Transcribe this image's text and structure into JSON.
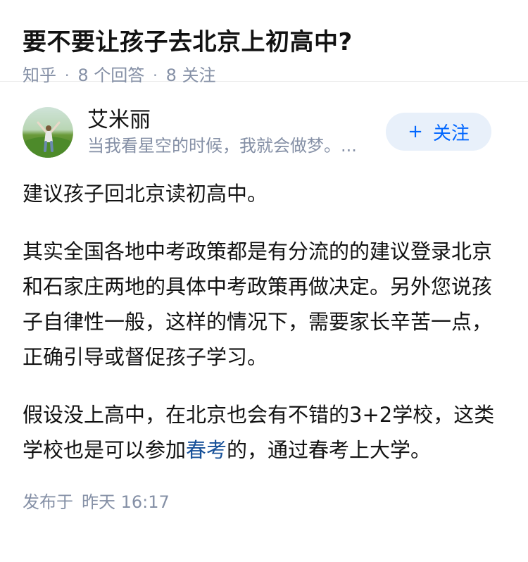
{
  "question": {
    "title": "要不要让孩子去北京上初高中?",
    "source": "知乎",
    "dot": "·",
    "answer_count": "8 个回答",
    "follower_count": "8 关注"
  },
  "answer": {
    "author_name": "艾米丽",
    "author_bio": "当我看星空的时候，我就会做梦。...",
    "follow_plus": "+",
    "follow_label": "关注",
    "paragraph1": "建议孩子回北京读初高中。",
    "paragraph2": "其实全国各地中考政策都是有分流的的建议登录北京和石家庄两地的具体中考政策再做决定。另外您说孩子自律性一般，这样的情况下，需要家长辛苦一点，正确引导或督促孩子学习。",
    "paragraph3_before": "假设没上高中，在北京也会有不错的3+2学校，这类学校也是可以参加",
    "paragraph3_link": "春考",
    "paragraph3_after": "的，通过春考上大学。",
    "publish_label": "发布于",
    "publish_time": "昨天 16:17"
  },
  "colors": {
    "link": "#175199",
    "meta": "#8590a6",
    "follow_bg": "#e8f0fa",
    "follow_text": "#0066ff"
  }
}
